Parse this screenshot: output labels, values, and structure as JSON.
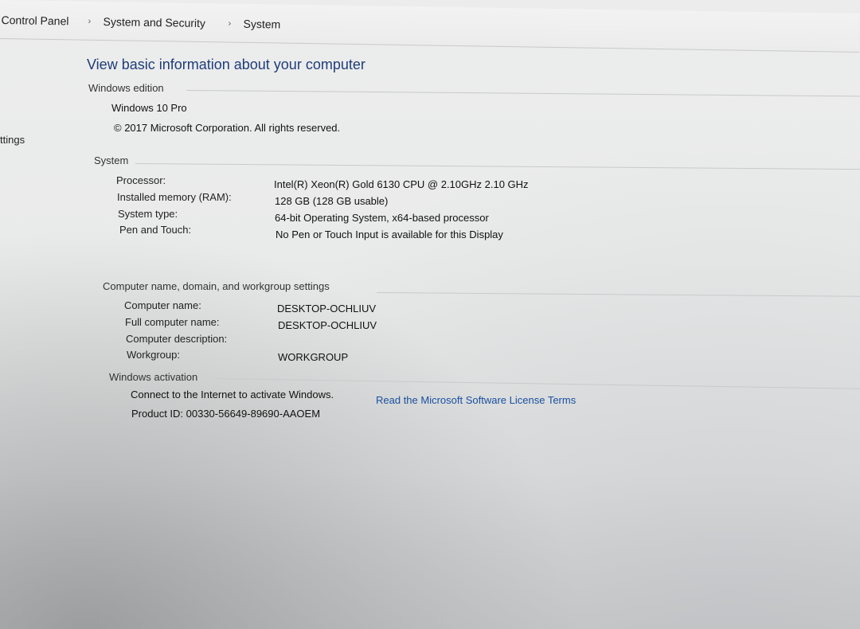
{
  "breadcrumb": {
    "items": [
      "Control Panel",
      "System and Security",
      "System"
    ],
    "separator": "›"
  },
  "sidebar": {
    "settings_fragment": "ttings"
  },
  "page_title": "View basic information about your computer",
  "windows_edition": {
    "heading": "Windows edition",
    "edition": "Windows 10 Pro",
    "copyright": "© 2017 Microsoft Corporation. All rights reserved."
  },
  "system": {
    "heading": "System",
    "rows": [
      {
        "label": "Processor:",
        "value": "Intel(R) Xeon(R) Gold 6130 CPU @ 2.10GHz   2.10 GHz"
      },
      {
        "label": "Installed memory (RAM):",
        "value": "128 GB (128 GB usable)"
      },
      {
        "label": "System type:",
        "value": "64-bit Operating System, x64-based processor"
      },
      {
        "label": "Pen and Touch:",
        "value": "No Pen or Touch Input is available for this Display"
      }
    ]
  },
  "computer_name": {
    "heading": "Computer name, domain, and workgroup settings",
    "rows": [
      {
        "label": "Computer name:",
        "value": "DESKTOP-OCHLIUV"
      },
      {
        "label": "Full computer name:",
        "value": "DESKTOP-OCHLIUV"
      },
      {
        "label": "Computer description:",
        "value": ""
      },
      {
        "label": "Workgroup:",
        "value": "WORKGROUP"
      }
    ]
  },
  "activation": {
    "heading": "Windows activation",
    "status": "Connect to the Internet to activate Windows.",
    "license_link": "Read the Microsoft Software License Terms",
    "product_id": "Product ID: 00330-56649-89690-AAOEM"
  }
}
